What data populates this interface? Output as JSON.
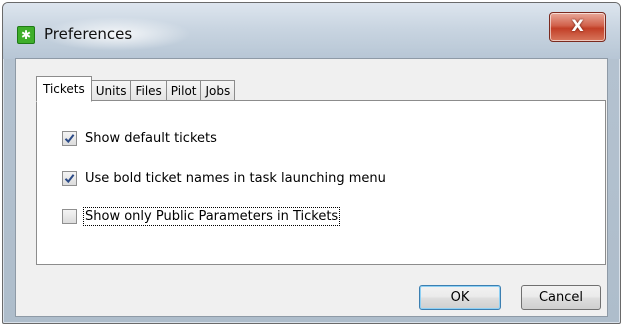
{
  "window": {
    "title": "Preferences",
    "app_icon": "gear-icon",
    "close_label": "X"
  },
  "tabs": [
    {
      "label": "Tickets",
      "active": true
    },
    {
      "label": "Units",
      "active": false
    },
    {
      "label": "Files",
      "active": false
    },
    {
      "label": "Pilot",
      "active": false
    },
    {
      "label": "Jobs",
      "active": false
    }
  ],
  "options": [
    {
      "label": "Show default tickets",
      "checked": true
    },
    {
      "label": "Use bold ticket names in task launching menu",
      "checked": true
    },
    {
      "label": "Show only Public Parameters in Tickets",
      "checked": false
    }
  ],
  "buttons": {
    "ok_label": "OK",
    "cancel_label": "Cancel"
  },
  "colors": {
    "accent": "#3c7fb1",
    "close": "#c23f27",
    "check": "#2b4a86"
  }
}
